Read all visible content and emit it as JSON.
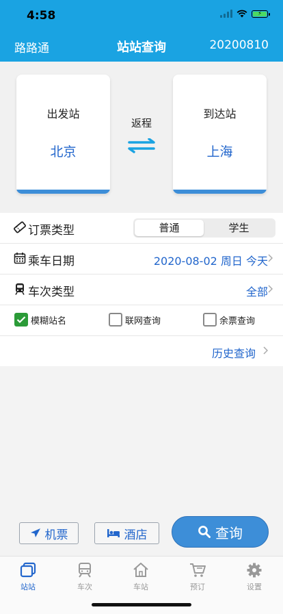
{
  "status": {
    "time": "4:58"
  },
  "nav": {
    "left": "路路通",
    "title": "站站查询",
    "right": "20200810"
  },
  "stations": {
    "from_label": "出发站",
    "from_city": "北京",
    "return_label": "返程",
    "to_label": "到达站",
    "to_city": "上海"
  },
  "ticket_type": {
    "label": "订票类型",
    "options": [
      "普通",
      "学生"
    ],
    "selected": "普通"
  },
  "date": {
    "label": "乘车日期",
    "value": "2020-08-02 周日 今天"
  },
  "train_type": {
    "label": "车次类型",
    "value": "全部"
  },
  "checks": [
    {
      "label": "模糊站名",
      "checked": true
    },
    {
      "label": "联网查询",
      "checked": false
    },
    {
      "label": "余票查询",
      "checked": false
    }
  ],
  "history": {
    "label": "历史查询"
  },
  "actions": {
    "plane": "机票",
    "hotel": "酒店",
    "query": "查询"
  },
  "tabs": [
    {
      "label": "站站",
      "icon": "layers-icon",
      "active": true
    },
    {
      "label": "车次",
      "icon": "train-icon",
      "active": false
    },
    {
      "label": "车站",
      "icon": "house-icon",
      "active": false
    },
    {
      "label": "预订",
      "icon": "cart-icon",
      "active": false
    },
    {
      "label": "设置",
      "icon": "gear-icon",
      "active": false
    }
  ],
  "colors": {
    "header": "#1aa3e2",
    "accent": "#2266cc",
    "button": "#3d8ed8",
    "checked": "#2b9b38"
  }
}
